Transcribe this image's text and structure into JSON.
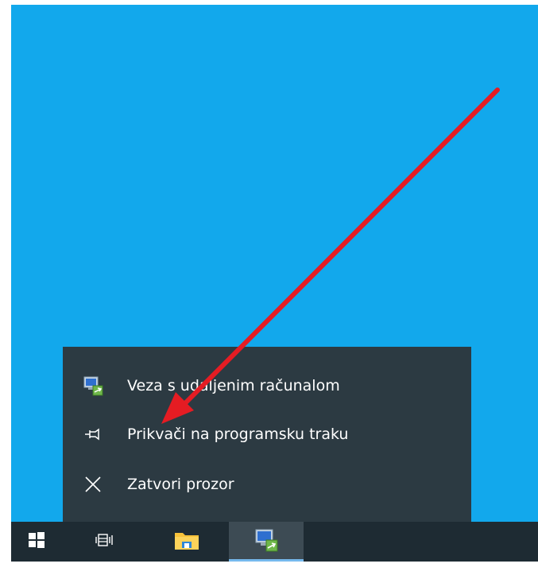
{
  "jump_list": {
    "items": [
      {
        "label": "Veza s udaljenim računalom",
        "icon": "remote-desktop-icon"
      },
      {
        "label": "Prikvači na programsku traku",
        "icon": "pin-icon"
      },
      {
        "label": "Zatvori prozor",
        "icon": "close-icon"
      }
    ]
  },
  "taskbar": {
    "buttons": [
      {
        "icon": "windows-start-icon"
      },
      {
        "icon": "task-view-icon"
      },
      {
        "icon": "file-explorer-icon"
      },
      {
        "icon": "remote-desktop-icon",
        "active": true
      }
    ]
  },
  "annotation": {
    "type": "arrow",
    "color": "#e51c23"
  },
  "colors": {
    "desktop": "#12a8ec",
    "jump_list_bg": "#2c3a42",
    "taskbar_bg": "#1e2b33",
    "active_button": "#3d4b54",
    "active_indicator": "#76b9ed"
  }
}
